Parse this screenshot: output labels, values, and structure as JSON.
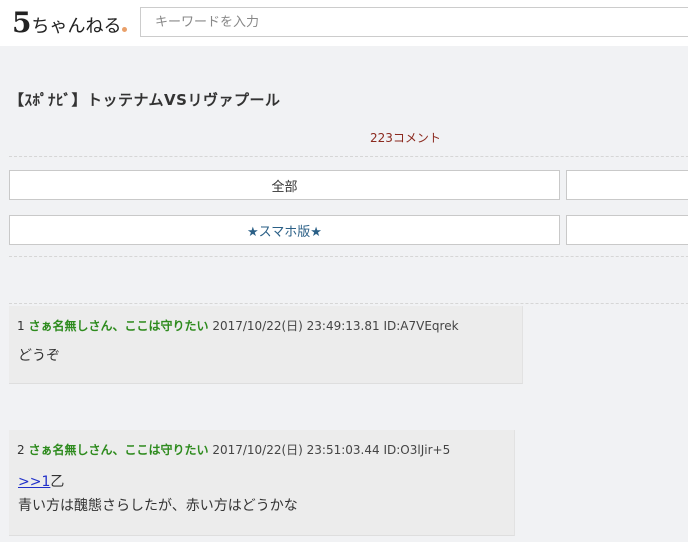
{
  "header": {
    "logo_five": "5",
    "logo_rest": "ちゃんねる",
    "search_placeholder": "キーワードを入力"
  },
  "thread": {
    "title": "【ｽﾎﾟﾅﾋﾞ】トッテナムVSリヴァプール",
    "comment_count": "223コメント"
  },
  "buttons": {
    "all": "全部",
    "smartphone": "★スマホ版★"
  },
  "posts": [
    {
      "number": "1",
      "name": "さぁ名無しさん、ここは守りたい",
      "datetime": "2017/10/22(日) 23:49:13.81",
      "id": "ID:A7VEqrek",
      "lines": [
        "どうぞ"
      ]
    },
    {
      "number": "2",
      "name": "さぁ名無しさん、ここは守りたい",
      "datetime": "2017/10/22(日) 23:51:03.44",
      "id": "ID:O3lJir+5",
      "anchor": ">>1",
      "anchor_suffix": "乙",
      "lines": [
        "青い方は醜態さらしたが、赤い方はどうかな"
      ]
    }
  ]
}
